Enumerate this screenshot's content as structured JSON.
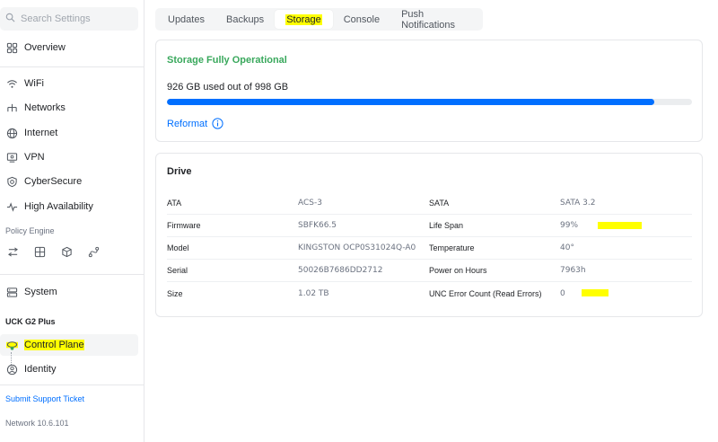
{
  "sidebar": {
    "search_placeholder": "Search Settings",
    "overview": "Overview",
    "wifi": "WiFi",
    "networks": "Networks",
    "internet": "Internet",
    "vpn": "VPN",
    "cybersecure": "CyberSecure",
    "high_availability": "High Availability",
    "policy_engine": "Policy Engine",
    "system": "System",
    "device_title": "UCK G2 Plus",
    "control_plane": "Control Plane",
    "identity": "Identity",
    "support_ticket": "Submit Support Ticket",
    "version": "Network 10.6.101"
  },
  "tabs": [
    "Updates",
    "Backups",
    "Storage",
    "Console",
    "Push Notifications"
  ],
  "storage": {
    "status": "Storage Fully Operational",
    "usage_text": "926 GB used out of 998 GB",
    "used_fraction": 0.928,
    "reformat_label": "Reformat"
  },
  "drive": {
    "title": "Drive",
    "rows": [
      {
        "k1": "ATA",
        "v1": "ACS-3",
        "k2": "SATA",
        "v2": "SATA 3.2"
      },
      {
        "k1": "Firmware",
        "v1": "SBFK66.5",
        "k2": "Life Span",
        "v2": "99%"
      },
      {
        "k1": "Model",
        "v1": "KINGSTON OCP0S31024Q-A0",
        "k2": "Temperature",
        "v2": "40°"
      },
      {
        "k1": "Serial",
        "v1": "50026B7686DD2712",
        "k2": "Power on Hours",
        "v2": "7963h"
      },
      {
        "k1": "Size",
        "v1": "1.02 TB",
        "k2": "UNC Error Count (Read Errors)",
        "v2": "0"
      }
    ]
  },
  "colors": {
    "accent": "#006fff",
    "success": "#39a85c",
    "highlight": "#ffff00"
  }
}
